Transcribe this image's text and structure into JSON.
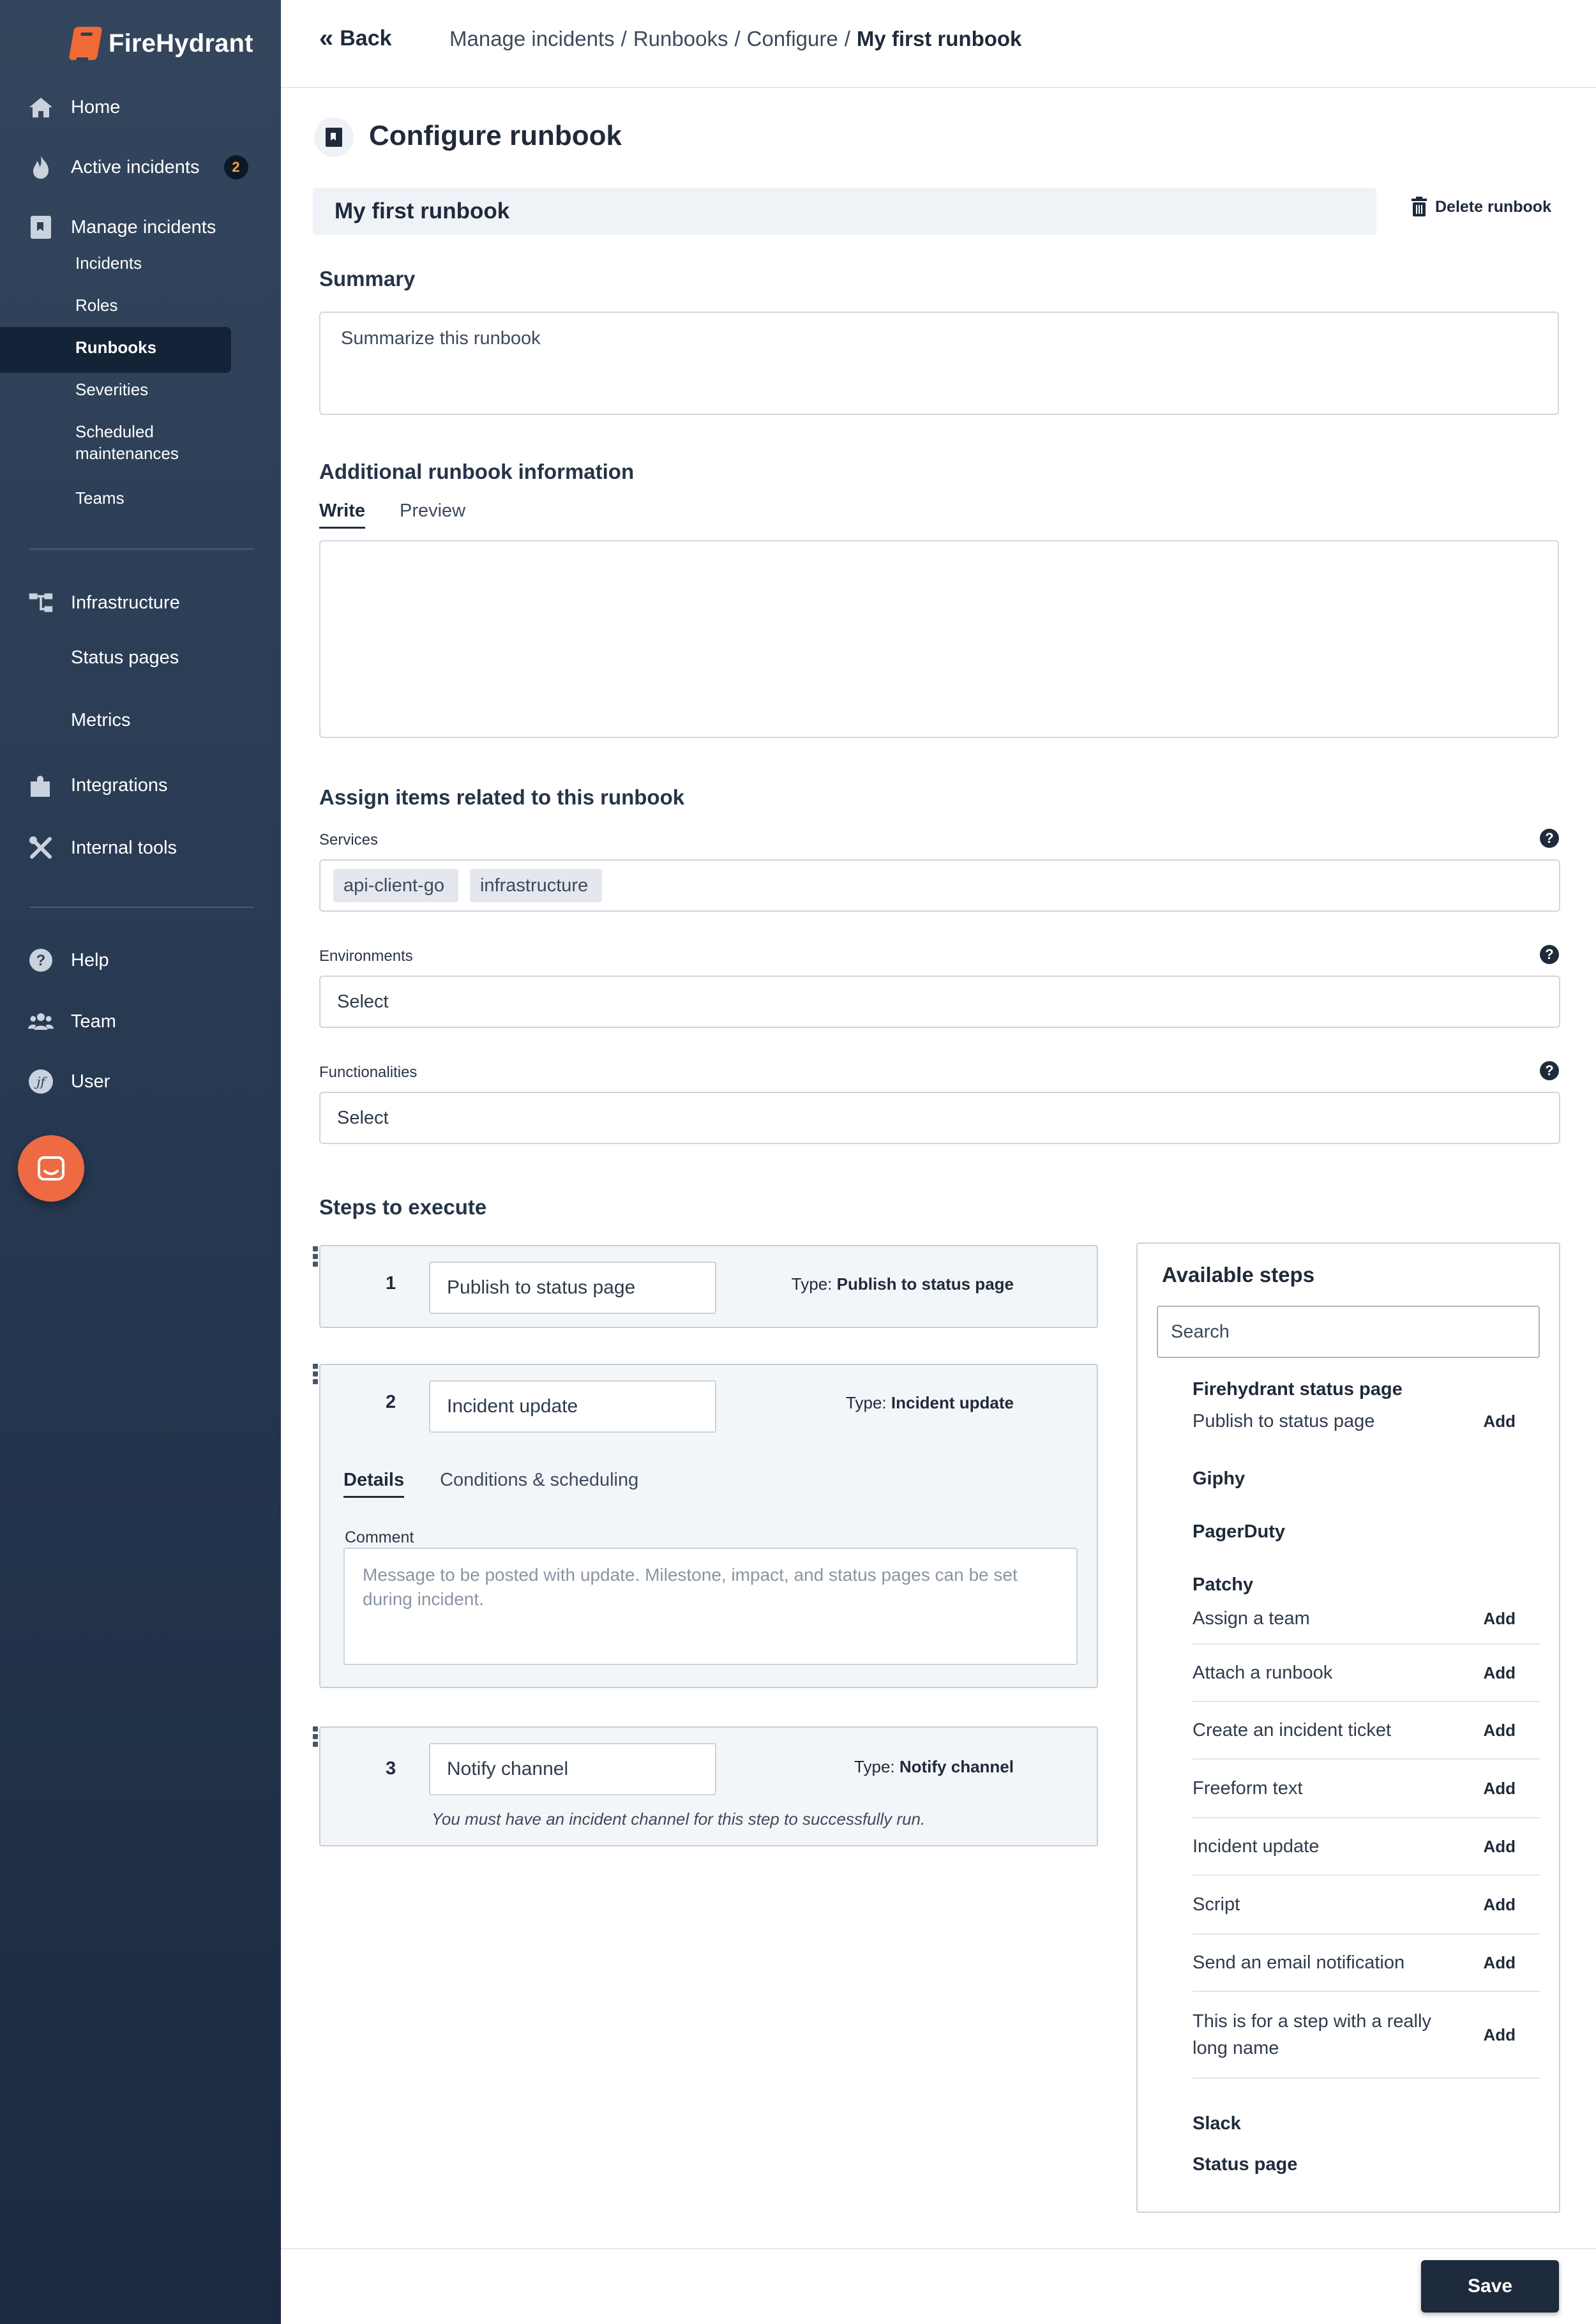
{
  "brand": {
    "name": "FireHydrant"
  },
  "sidebar": {
    "items": [
      {
        "label": "Home",
        "icon": "home-icon"
      },
      {
        "label": "Active incidents",
        "icon": "flame-icon",
        "badge": "2"
      },
      {
        "label": "Manage incidents",
        "icon": "runbook-icon"
      },
      {
        "label": "Infrastructure",
        "icon": "hierarchy-icon"
      },
      {
        "label": "Status pages"
      },
      {
        "label": "Metrics"
      },
      {
        "label": "Integrations",
        "icon": "puzzle-icon"
      },
      {
        "label": "Internal tools",
        "icon": "tools-icon"
      },
      {
        "label": "Help",
        "icon": "help-icon"
      },
      {
        "label": "Team",
        "icon": "team-icon"
      },
      {
        "label": "User",
        "icon": "user-avatar-icon"
      }
    ],
    "sub_items": [
      "Incidents",
      "Roles",
      "Runbooks",
      "Severities",
      "Scheduled maintenances",
      "Teams"
    ],
    "active_sub": "Runbooks"
  },
  "topbar": {
    "back_label": "Back",
    "breadcrumbs": [
      "Manage incidents",
      "Runbooks",
      "Configure",
      "My first runbook"
    ]
  },
  "page": {
    "title": "Configure runbook",
    "runbook_name": "My first runbook",
    "delete_label": "Delete runbook",
    "summary_label": "Summary",
    "summary_placeholder": "Summarize this runbook",
    "additional_label": "Additional runbook information",
    "tabs": [
      "Write",
      "Preview"
    ],
    "assign_label": "Assign items related to this runbook",
    "services_label": "Services",
    "services": [
      "api-client-go",
      "infrastructure"
    ],
    "environments_label": "Environments",
    "environments_value": "Select",
    "functionalities_label": "Functionalities",
    "functionalities_value": "Select",
    "steps_label": "Steps to execute"
  },
  "steps": [
    {
      "number": "1",
      "name": "Publish to status page",
      "type_prefix": "Type:",
      "type": "Publish to status page"
    },
    {
      "number": "2",
      "name": "Incident update",
      "type_prefix": "Type:",
      "type": "Incident update",
      "tabs": [
        "Details",
        "Conditions & scheduling"
      ],
      "comment_label": "Comment",
      "comment_placeholder": "Message to be posted with update. Milestone, impact, and status pages can be set during incident."
    },
    {
      "number": "3",
      "name": "Notify channel",
      "type_prefix": "Type:",
      "type": "Notify channel",
      "note": "You must have an incident channel for this step to successfully run."
    }
  ],
  "available_steps": {
    "title": "Available steps",
    "search_placeholder": "Search",
    "add_label": "Add",
    "groups": [
      {
        "name": "Firehydrant status page",
        "items": [
          "Publish to status page"
        ]
      },
      {
        "name": "Giphy",
        "items": []
      },
      {
        "name": "PagerDuty",
        "items": []
      },
      {
        "name": "Patchy",
        "items": [
          "Assign a team",
          "Attach a runbook",
          "Create an incident ticket",
          "Freeform text",
          "Incident update",
          "Script",
          "Send an email notification",
          "This is for a step with a really long name"
        ]
      },
      {
        "name": "Slack",
        "items": []
      },
      {
        "name": "Status page",
        "items": []
      }
    ]
  },
  "footer": {
    "save_label": "Save"
  },
  "colors": {
    "sidebar": "#2c3e55",
    "accent": "#f06a35",
    "badge_text": "#f4a340",
    "save_button": "#1e2b3c"
  }
}
